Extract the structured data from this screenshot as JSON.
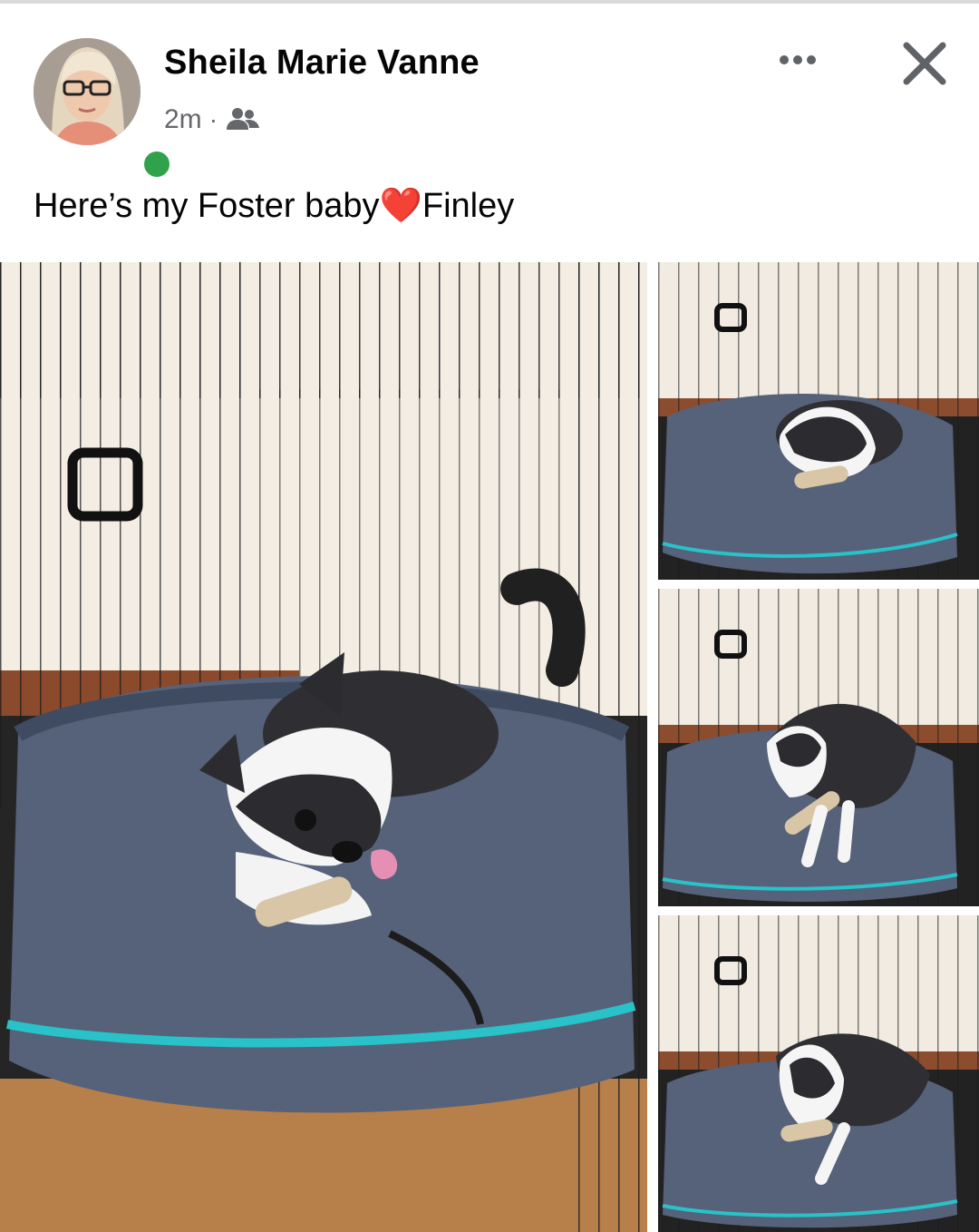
{
  "post": {
    "author_name": "Sheila Marie Vanne",
    "timestamp": "2m",
    "separator": "·",
    "audience_icon": "friends-icon",
    "caption_before": "Here’s my Foster baby",
    "caption_emoji": "❤️",
    "caption_after": "Finley",
    "more_icon": "more-horizontal-icon",
    "close_icon": "close-icon"
  },
  "colors": {
    "online_status": "#31a24c",
    "author_text": "#050505",
    "meta_text": "#65676b",
    "heart": "#e41e3f"
  },
  "photos": [
    {
      "name": "main-photo",
      "subject": "puppy lying on dog bed in crate chewing"
    },
    {
      "name": "thumbnail-1",
      "subject": "puppy lying on bed chewing bone"
    },
    {
      "name": "thumbnail-2",
      "subject": "puppy standing over bone"
    },
    {
      "name": "thumbnail-3",
      "subject": "puppy sniffing bed"
    }
  ]
}
